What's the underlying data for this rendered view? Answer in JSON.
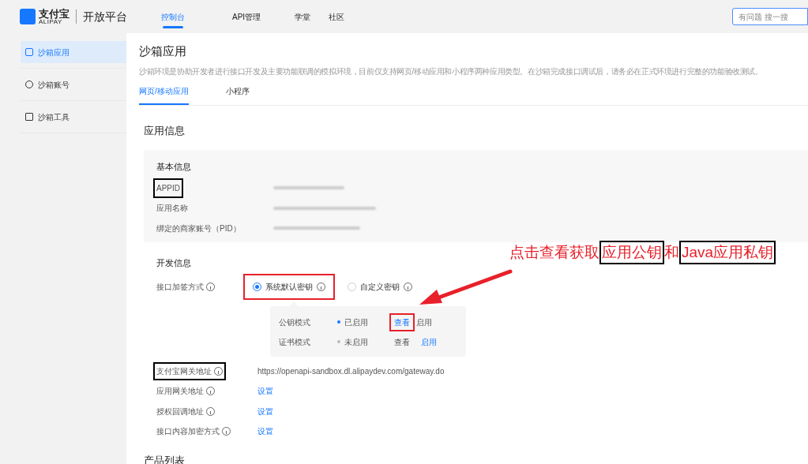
{
  "header": {
    "logo_text": "支付宝",
    "logo_sub": "ALIPAY",
    "platform": "开放平台",
    "nav": [
      {
        "label": "控制台",
        "selected": true
      },
      {
        "label": "API管理",
        "selected": false
      },
      {
        "label": "学堂",
        "selected": false
      },
      {
        "label": "社区",
        "selected": false
      }
    ],
    "search": {
      "placeholder": "有问题 搜一搜"
    }
  },
  "sidebar": {
    "items": [
      {
        "label": "沙箱应用",
        "selected": true
      },
      {
        "label": "沙箱账号",
        "selected": false
      },
      {
        "label": "沙箱工具",
        "selected": false
      }
    ]
  },
  "page": {
    "title": "沙箱应用",
    "description": "沙箱环境是协助开发者进行接口开发及主要功能联调的模拟环境，目前仅支持网页/移动应用和小程序两种应用类型。在沙箱完成接口调试后，请务必在正式环境进行完整的功能验收测试。",
    "tabs": [
      {
        "label": "网页/移动应用",
        "selected": true
      },
      {
        "label": "小程序",
        "selected": false
      }
    ]
  },
  "app_info": {
    "title": "应用信息",
    "basic": {
      "title": "基本信息",
      "rows": [
        {
          "label": "APPID",
          "boxed": true
        },
        {
          "label": "应用名称",
          "boxed": false
        },
        {
          "label": "绑定的商家账号（PID）",
          "boxed": false
        }
      ]
    },
    "dev": {
      "title": "开发信息",
      "sign_label": "接口加签方式",
      "options": [
        {
          "label": "系统默认密钥",
          "selected": true,
          "boxed": true
        },
        {
          "label": "自定义密钥",
          "selected": false,
          "boxed": false
        }
      ],
      "modes": [
        {
          "label": "公钥模式",
          "status": "已启用",
          "enabled": true,
          "view": "查看",
          "view_active": true,
          "view_boxed": true,
          "enable": "启用",
          "enable_active": false
        },
        {
          "label": "证书模式",
          "status": "未启用",
          "enabled": false,
          "view": "查看",
          "view_active": false,
          "view_boxed": false,
          "enable": "启用",
          "enable_active": true
        }
      ],
      "rows": [
        {
          "label": "支付宝网关地址",
          "boxed": true,
          "kind": "text",
          "value": "https://openapi-sandbox.dl.alipaydev.com/gateway.do"
        },
        {
          "label": "应用网关地址",
          "boxed": false,
          "kind": "link",
          "value": "设置"
        },
        {
          "label": "授权回调地址",
          "boxed": false,
          "kind": "link",
          "value": "设置"
        },
        {
          "label": "接口内容加密方式",
          "boxed": false,
          "kind": "link",
          "value": "设置"
        }
      ]
    }
  },
  "products": {
    "title": "产品列表"
  },
  "annotation": {
    "parts": [
      {
        "text": "点击查看获取",
        "boxed": false
      },
      {
        "text": "应用公钥",
        "boxed": true
      },
      {
        "text": "和",
        "boxed": false
      },
      {
        "text": "Java应用私钥",
        "boxed": true
      }
    ]
  }
}
